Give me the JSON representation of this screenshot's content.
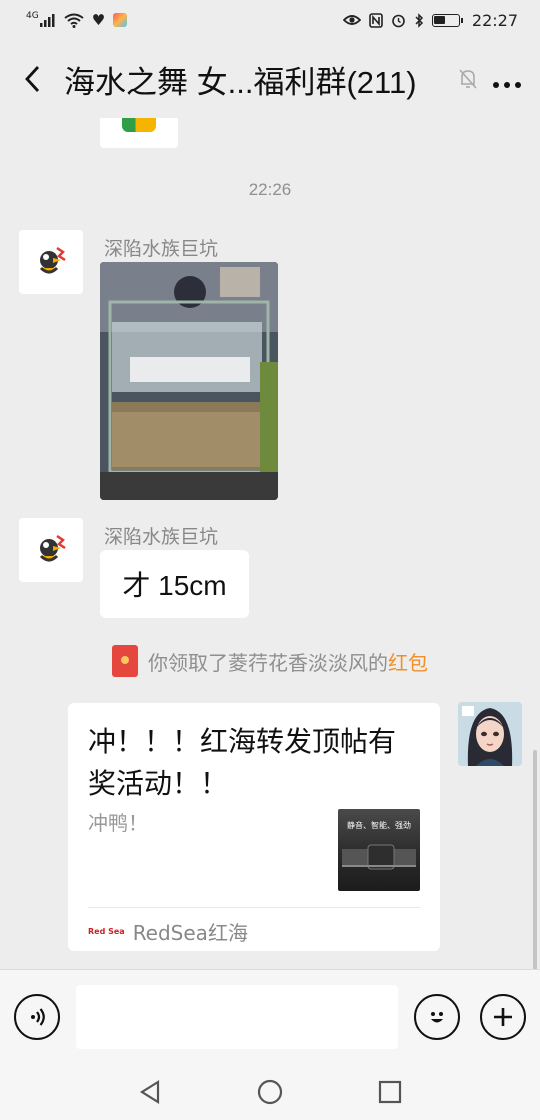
{
  "status_bar": {
    "signal_label": "4G",
    "time": "22:27",
    "battery_level": 0.45
  },
  "header": {
    "title": "海水之舞 女...福利群(211)",
    "back_icon": "chevron-left-icon",
    "mute_icon": "bell-off-icon",
    "more_icon": "more-dots-icon"
  },
  "messages": {
    "timestamp": "22:26",
    "msg1": {
      "sender": "深陷水族巨坑",
      "type": "image"
    },
    "msg2": {
      "sender": "深陷水族巨坑",
      "text": "才 15cm"
    },
    "system": {
      "prefix": "你领取了菱荇花香淡淡风的",
      "link": "红包"
    },
    "card": {
      "title": "冲！！！红海转发顶帖有奖活动！！",
      "description": "冲鸭！",
      "thumbnail_text": "静音、智能、强劲",
      "source_logo": "Red Sea",
      "source": "RedSea红海"
    }
  },
  "input_bar": {
    "voice_icon": "voice-icon",
    "emoji_icon": "emoji-icon",
    "plus_icon": "plus-icon"
  },
  "system_nav": {
    "back": "triangle-back-icon",
    "home": "circle-home-icon",
    "recents": "square-recents-icon"
  }
}
